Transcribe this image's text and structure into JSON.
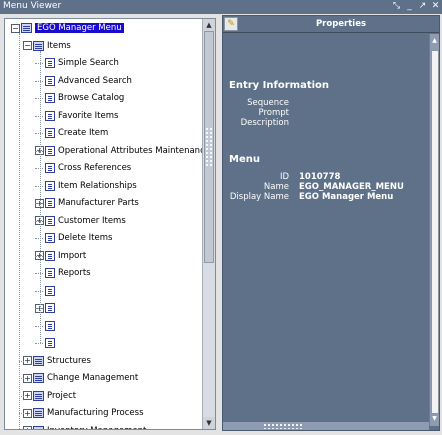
{
  "window": {
    "title": "Menu Viewer",
    "controls": [
      "restore",
      "minimize",
      "maximize",
      "close"
    ]
  },
  "tree": {
    "root": {
      "label": "EGO Manager Menu",
      "expanded": true,
      "selected": true
    },
    "items_folder": {
      "label": "Items",
      "expanded": true
    },
    "items_children": [
      {
        "label": "Simple Search",
        "has_children": false
      },
      {
        "label": "Advanced Search",
        "has_children": false
      },
      {
        "label": "Browse Catalog",
        "has_children": false
      },
      {
        "label": "Favorite Items",
        "has_children": false
      },
      {
        "label": "Create Item",
        "has_children": false
      },
      {
        "label": "Operational Attributes Maintenance",
        "has_children": true
      },
      {
        "label": "Cross References",
        "has_children": false
      },
      {
        "label": "Item Relationships",
        "has_children": false
      },
      {
        "label": "Manufacturer Parts",
        "has_children": true
      },
      {
        "label": "Customer Items",
        "has_children": true
      },
      {
        "label": "Delete Items",
        "has_children": false
      },
      {
        "label": "Import",
        "has_children": true
      },
      {
        "label": "Reports",
        "has_children": false
      },
      {
        "label": "",
        "has_children": false
      },
      {
        "label": "",
        "has_children": true
      },
      {
        "label": "",
        "has_children": false
      },
      {
        "label": "",
        "has_children": false
      }
    ],
    "top_folders": [
      {
        "label": "Structures"
      },
      {
        "label": "Change Management"
      },
      {
        "label": "Project"
      },
      {
        "label": "Manufacturing Process"
      },
      {
        "label": "Inventory Management"
      }
    ]
  },
  "properties": {
    "header_title": "Properties",
    "entry_section": {
      "title": "Entry Information",
      "rows": [
        {
          "key": "Sequence",
          "value": ""
        },
        {
          "key": "Prompt",
          "value": ""
        },
        {
          "key": "Description",
          "value": ""
        }
      ]
    },
    "menu_section": {
      "title": "Menu",
      "rows": [
        {
          "key": "ID",
          "value": "1010778"
        },
        {
          "key": "Name",
          "value": "EGO_MANAGER_MENU"
        },
        {
          "key": "Display Name",
          "value": "EGO Manager Menu"
        }
      ]
    }
  },
  "colors": {
    "titlebar": "#5e7188",
    "panel": "#5e7188",
    "selection": "#1a0ccf",
    "tree_background": "#ffffff"
  },
  "icons": [
    "folder-icon",
    "menu-entry-icon",
    "expand-icon",
    "collapse-icon",
    "pin-icon"
  ]
}
